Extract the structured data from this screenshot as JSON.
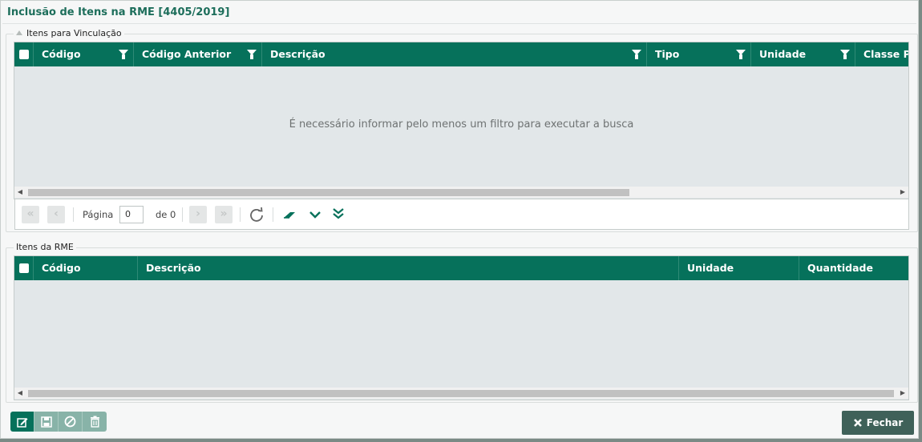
{
  "window": {
    "title": "Inclusão de Itens na RME [4405/2019]"
  },
  "vinculacao": {
    "legend": "Itens para Vinculação",
    "columns": [
      "Código",
      "Código Anterior",
      "Descrição",
      "Tipo",
      "Unidade",
      "Classe Pa"
    ],
    "empty_message": "É necessário informar pelo menos um filtro para executar a busca",
    "pager": {
      "page_label": "Página",
      "page_value": "0",
      "of_label": "de 0"
    }
  },
  "rme": {
    "legend": "Itens da RME",
    "columns": [
      "Código",
      "Descrição",
      "Unidade",
      "Quantidade"
    ]
  },
  "footer": {
    "close_label": "Fechar"
  },
  "colors": {
    "header": "#06715b",
    "button_dark": "#3f6159",
    "button_light": "#88b3a8"
  }
}
